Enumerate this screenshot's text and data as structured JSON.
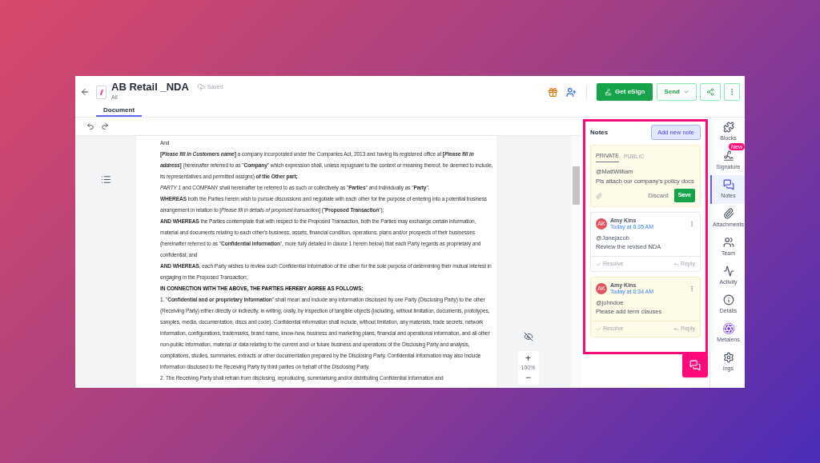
{
  "header": {
    "title": "AB Retail _NDA",
    "subtitle": "All",
    "save_status": "Saved",
    "actions": {
      "esign": "Get eSign",
      "send": "Send"
    }
  },
  "tabs": [
    {
      "label": "Document",
      "selected": true
    }
  ],
  "document": {
    "paragraphs": [
      {
        "kind": "body",
        "text": "And"
      },
      {
        "kind": "body",
        "text": "**[*Please fill in Customers name*]** a company incorporated under the Companies Act, 2013 and having its registered office at **[*Please fill in address*]** (hereinafter referred to as \"**Company**\" which expression shall, unless repugnant to the context or meaning thereof, be deemed to include, its representatives and permitted assigns) **of the Other part;**"
      },
      {
        "kind": "body",
        "text": "*PARTY 1* and COMPANY shall hereinafter be referred to as such or collectively as \"**Parties**\" and individually as \"**Party**\"."
      },
      {
        "kind": "body",
        "text": "**WHEREAS** both the Parties herein wish to pursue discussions and negotiate with each other for the purpose of entering into a potential business arrangement in relation to [*Please fill in details of proposed transaction*] (\"**Proposed Transaction**\");"
      },
      {
        "kind": "body",
        "text": "**AND WHEREAS** the Parties contemplate that with respect to the Proposed Transaction, both the Parties may exchange certain information, material and documents relating to each other's business, assets, financial condition, operations, plans and/or prospects of their businesses (hereinafter referred to as \"**Confidential Information**\", more fully detailed in clause 1 herein below) that each Party regards as proprietary and confidential; and"
      },
      {
        "kind": "body",
        "text": "**AND WHEREAS**, each Party wishes to review such Confidential Information of the other for the sole purpose of determining their mutual interest in engaging in the Proposed Transaction;"
      },
      {
        "kind": "heading",
        "text": "IN CONNECTION WITH THE ABOVE, THE PARTIES HEREBY AGREE AS FOLLOWS:"
      },
      {
        "kind": "body",
        "text": "1. \"**Confidential and or proprietary Information**\" shall mean and include any information disclosed by one Party (Disclosing Party) to the other (Receiving Party) either directly or indirectly, in writing, orally, by inspection of tangible objects (including, without limitation, documents, prototypes, samples, media, documentation, discs and code). Confidential information shall include, without limitation, any materials, trade secrets, network information, configurations, trademarks, brand name, know-how, business and marketing plans, financial and operational information, and all other non-public information, material or data relating to the current and/ or future business and operations of the Disclosing Party and analysis, compilations, studies, summaries, extracts or other documentation prepared by the Disclosing Party. Confidential Information may also include information disclosed to the Receiving Party by third parties on behalf of the Disclosing Party."
      },
      {
        "kind": "body",
        "text": "2. The Receiving Party shall refrain from disclosing, reproducing, summarising and/or distributing Confidential Information and"
      }
    ]
  },
  "zoom": {
    "in": "+",
    "level": "100%",
    "out": "−"
  },
  "notes": {
    "title": "Notes",
    "add_button": "Add new note",
    "draft": {
      "tabs": [
        {
          "label": "PRIVATE",
          "selected": true
        },
        {
          "label": "PUBLIC",
          "selected": false
        }
      ],
      "mention": "@MattWilliam",
      "text": "Pls attach our company's policy docs",
      "discard": "Discard",
      "save": "Save"
    },
    "comments": [
      {
        "initials": "AK",
        "author": "Amy Kins",
        "time": "Today at 6:35 AM",
        "mention": "@Janejacob",
        "text": "Review the revised NDA",
        "resolve": "Resolve",
        "reply": "Reply",
        "highlighted": false
      },
      {
        "initials": "AK",
        "author": "Amy Kins",
        "time": "Today at 6:34 AM",
        "mention": "@johndoe",
        "text": "Please add term clauses",
        "resolve": "Resolve",
        "reply": "Reply",
        "highlighted": true
      }
    ]
  },
  "rail": [
    {
      "kind": "blocks",
      "label": "Blocks",
      "selected": false
    },
    {
      "kind": "signature",
      "label": "Signature",
      "badge": "New",
      "selected": false
    },
    {
      "kind": "notes",
      "label": "Notes",
      "selected": true
    },
    {
      "kind": "attachments",
      "label": "Attachments",
      "selected": false
    },
    {
      "kind": "team",
      "label": "Team",
      "selected": false
    },
    {
      "kind": "activity",
      "label": "Activity",
      "selected": false
    },
    {
      "kind": "details",
      "label": "Details",
      "selected": false
    },
    {
      "kind": "metalens",
      "label": "Metalens",
      "selected": false
    },
    {
      "kind": "settings",
      "label": "ings",
      "selected": false
    }
  ]
}
